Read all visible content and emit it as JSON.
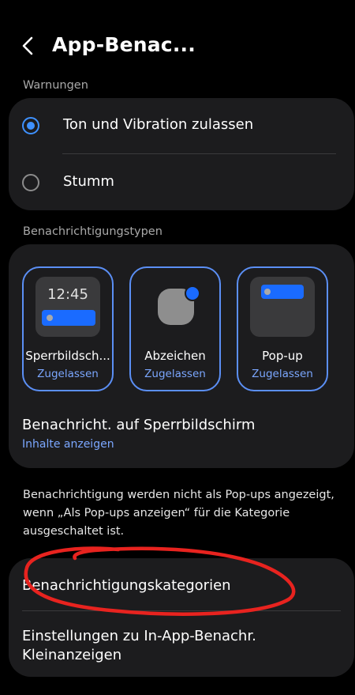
{
  "header": {
    "title": "App-Benac..."
  },
  "warnings": {
    "label": "Warnungen",
    "options": [
      {
        "label": "Ton und Vibration zulassen",
        "selected": true
      },
      {
        "label": "Stumm",
        "selected": false
      }
    ]
  },
  "types": {
    "label": "Benachrichtigungstypen",
    "tiles": [
      {
        "title": "Sperrbildsch...",
        "status": "Zugelassen",
        "preview_time": "12:45"
      },
      {
        "title": "Abzeichen",
        "status": "Zugelassen"
      },
      {
        "title": "Pop-up",
        "status": "Zugelassen"
      }
    ],
    "lockscreen_row": {
      "title": "Benachricht. auf Sperrbildschirm",
      "subtitle": "Inhalte anzeigen"
    }
  },
  "info": {
    "text": "Benachrichtigung werden nicht als Pop-ups angezeigt, wenn „Als Pop-ups anzeigen“ für die Kategorie ausgeschaltet ist."
  },
  "bottom": {
    "categories_label": "Benachrichtigungskategorien",
    "inapp_label": "Einstellungen zu In-App-Benachr.",
    "inapp_sub": "Kleinanzeigen"
  },
  "colors": {
    "accent": "#3e91ff",
    "link": "#7ba7ff",
    "card": "#1c1c1e",
    "annotation": "#e8231f"
  }
}
